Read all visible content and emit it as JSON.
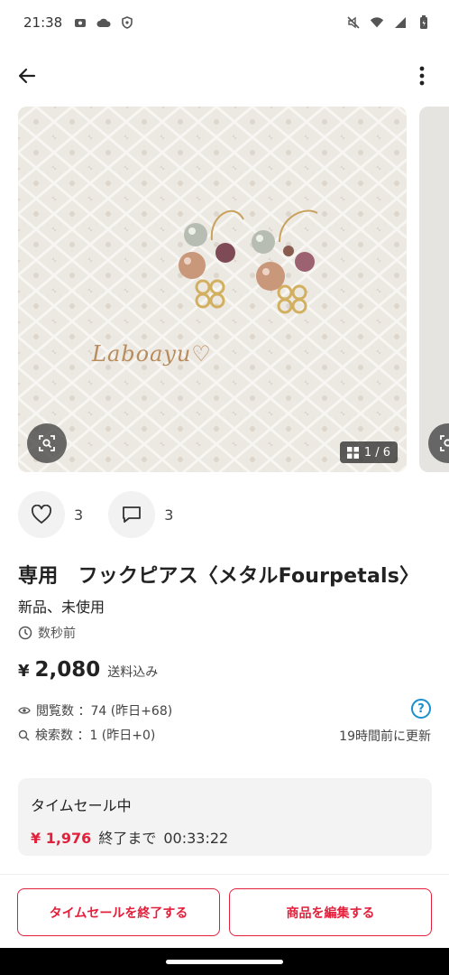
{
  "status_bar": {
    "time": "21:38",
    "left_icons": [
      "app-icon",
      "cloud-icon",
      "shield-icon"
    ],
    "right_icons": [
      "mute-icon",
      "wifi-icon",
      "signal-icon",
      "battery-icon"
    ]
  },
  "app_bar": {
    "back_icon": "arrow-left-icon",
    "menu_icon": "more-vertical-icon"
  },
  "gallery": {
    "watermark": "Laboayu♡",
    "counter": "1 / 6"
  },
  "actions": {
    "likes": "3",
    "comments": "3"
  },
  "item": {
    "title": "専用　フックピアス〈メタルFourpetals〉",
    "condition": "新品、未使用",
    "posted": "数秒前",
    "price_symbol": "¥",
    "price": "2,080",
    "shipping": "送料込み"
  },
  "stats": {
    "views": "閲覧数 ：74 (昨日+68)",
    "searches": "検索数 ：1 (昨日+0)",
    "updated": "19時間前に更新",
    "help": "?"
  },
  "time_sale": {
    "title": "タイムセール中",
    "price": "¥ 1,976",
    "until_label": "終了まで",
    "remaining": "00:33:22"
  },
  "buttons": {
    "end_sale": "タイムセールを終了する",
    "edit": "商品を編集する"
  },
  "colors": {
    "accent": "#e2203c",
    "help": "#1a8fd0"
  }
}
